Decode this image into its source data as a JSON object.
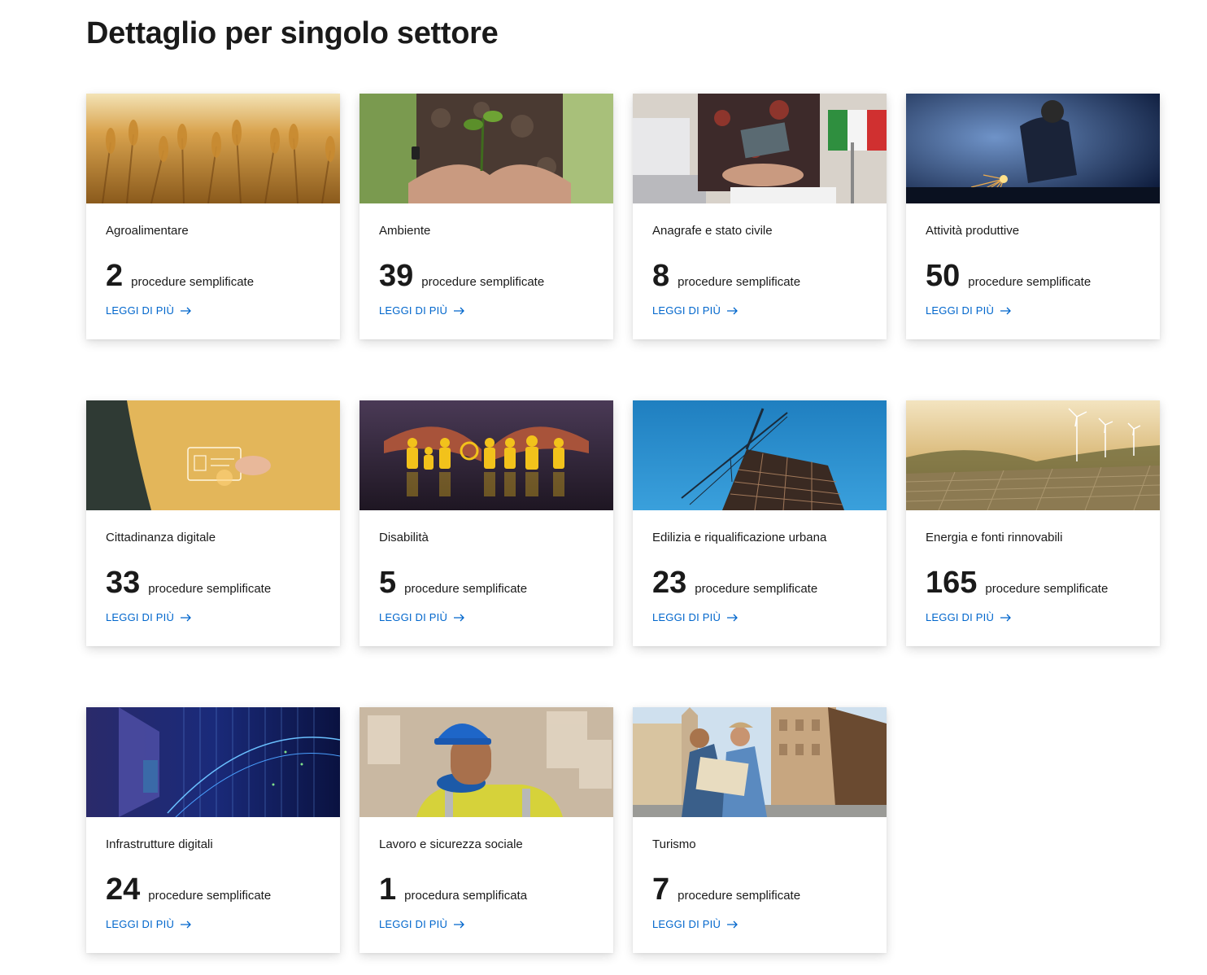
{
  "page": {
    "title": "Dettaglio per singolo settore"
  },
  "link_label": "LEGGI DI PIÙ",
  "colors": {
    "link": "#0066cc",
    "text": "#1a1a1a"
  },
  "cards": [
    {
      "title": "Agroalimentare",
      "count": "2",
      "unit": "procedure semplificate",
      "image": "wheat-field-image"
    },
    {
      "title": "Ambiente",
      "count": "39",
      "unit": "procedure semplificate",
      "image": "seedling-hands-image"
    },
    {
      "title": "Anagrafe e stato civile",
      "count": "8",
      "unit": "procedure semplificate",
      "image": "passport-flag-image"
    },
    {
      "title": "Attività produttive",
      "count": "50",
      "unit": "procedure semplificate",
      "image": "welder-sparks-image"
    },
    {
      "title": "Cittadinanza digitale",
      "count": "33",
      "unit": "procedure semplificate",
      "image": "digital-id-card-image"
    },
    {
      "title": "Disabilità",
      "count": "5",
      "unit": "procedure semplificate",
      "image": "paper-figures-hands-image"
    },
    {
      "title": "Edilizia e riqualificazione urbana",
      "count": "23",
      "unit": "procedure semplificate",
      "image": "crane-building-image"
    },
    {
      "title": "Energia e fonti rinnovabili",
      "count": "165",
      "unit": "procedure semplificate",
      "image": "wind-solar-image"
    },
    {
      "title": "Infrastrutture digitali",
      "count": "24",
      "unit": "procedure semplificate",
      "image": "server-room-image"
    },
    {
      "title": "Lavoro e sicurezza sociale",
      "count": "1",
      "unit": "procedura semplificata",
      "image": "worker-hardhat-image"
    },
    {
      "title": "Turismo",
      "count": "7",
      "unit": "procedure semplificate",
      "image": "tourists-map-image"
    }
  ]
}
